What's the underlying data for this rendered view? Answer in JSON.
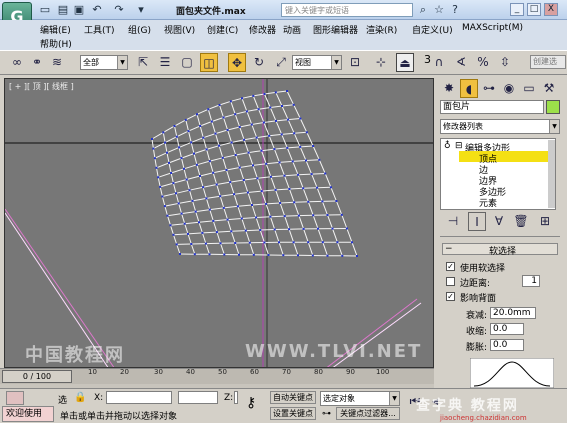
{
  "window": {
    "title": "面包夹文件.max",
    "search_placeholder": "键入关键字或短语",
    "min": "_",
    "restore": "□",
    "close": "X",
    "logo": "G"
  },
  "titlebar_icons": [
    "new-icon",
    "open-icon",
    "save-icon",
    "undo-icon",
    "redo-icon"
  ],
  "menus": [
    "编辑(E)",
    "工具(T)",
    "组(G)",
    "视图(V)",
    "创建(C)",
    "修改器",
    "动画",
    "图形编辑器",
    "渲染(R)",
    "自定义(U)",
    "MAXScript(M)",
    "帮助(H)"
  ],
  "toolbar": {
    "filter": "全部",
    "refcoord": "视图",
    "spinner_label": "3",
    "create_sel": "创建选"
  },
  "viewport": {
    "label": "[ + ][ 顶 ][ 线框 ]"
  },
  "panel": {
    "object_name": "面包片",
    "modifier_list": "修改器列表",
    "stack": [
      {
        "label": "编辑多边形",
        "level": 0,
        "selected": false
      },
      {
        "label": "顶点",
        "level": 1,
        "selected": true
      },
      {
        "label": "边",
        "level": 1,
        "selected": false
      },
      {
        "label": "边界",
        "level": 1,
        "selected": false
      },
      {
        "label": "多边形",
        "level": 1,
        "selected": false
      },
      {
        "label": "元素",
        "level": 1,
        "selected": false
      }
    ],
    "rollout_title": "软选择",
    "use_soft": "使用软选择",
    "edge_dist": "边距离:",
    "edge_dist_val": "1",
    "affect_back": "影响背面",
    "falloff": "衰减:",
    "falloff_val": "20.0mm",
    "pinch": "收缩:",
    "pinch_val": "0.0",
    "bubble": "膨胀:",
    "bubble_val": "0.0"
  },
  "timeline": {
    "slider": "0 / 100",
    "ticks": [
      "0",
      "10",
      "20",
      "30",
      "40",
      "50",
      "60",
      "70",
      "80",
      "90",
      "100"
    ]
  },
  "status": {
    "welcome": "欢迎使用",
    "sel_label": "选",
    "prompt": "单击或单击并拖动以选择对象",
    "x_label": "X:",
    "z_label": "Z:",
    "auto_key": "自动关键点",
    "set_key": "设置关键点",
    "sel_object": "选定对象",
    "key_filter": "关键点过滤器..."
  },
  "watermark": "中国教程网",
  "watermark2": "WWW.TLVI.NET",
  "watermark3": "jiaocheng.chazidian.com",
  "watermark4": "查字典 教程网"
}
